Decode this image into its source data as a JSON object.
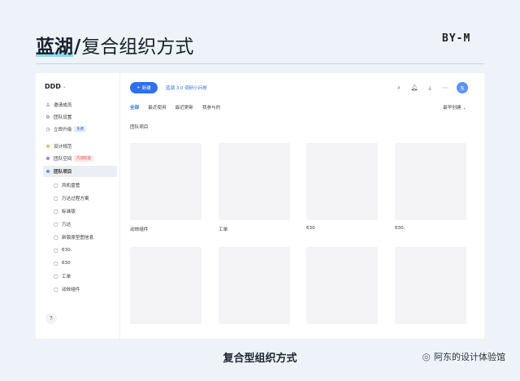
{
  "header": {
    "brand": "蓝湖",
    "separator": "/",
    "subtitle": "复合组织方式",
    "author": "BY-M"
  },
  "sidebar": {
    "workspace": "DDD",
    "top_items": [
      {
        "label": "邀请成员",
        "icon": "add-user-icon"
      },
      {
        "label": "团队设置",
        "icon": "gear-icon"
      },
      {
        "label": "立即升级",
        "icon": "clock-icon",
        "badge": "免费"
      }
    ],
    "groups": [
      {
        "label": "设计规范",
        "color": "#f2b36b"
      },
      {
        "label": "团队空间",
        "color": "#8f7ff0",
        "badge": "内测新版"
      },
      {
        "label": "团队项目",
        "color": "#5b8ff7"
      }
    ],
    "projects": [
      "风机盘管",
      "万达过程方案",
      "标准版",
      "万达",
      "新版原型图信息",
      "630.",
      "630",
      "工单",
      "动效组件"
    ],
    "help": "?"
  },
  "toolbar": {
    "new_label": "新建",
    "link": "蓝湖 3.0 调研小问卷",
    "avatar": "东"
  },
  "tabs": [
    "全部",
    "最近使用",
    "最近更新",
    "我参与的"
  ],
  "sort": {
    "label": "最早创建"
  },
  "section_title": "团队项目",
  "cards": [
    "动效组件",
    "工单",
    "630",
    "630.",
    "",
    "",
    "",
    ""
  ],
  "caption": "复合型组织方式",
  "watermark": "阿东的设计体验馆"
}
